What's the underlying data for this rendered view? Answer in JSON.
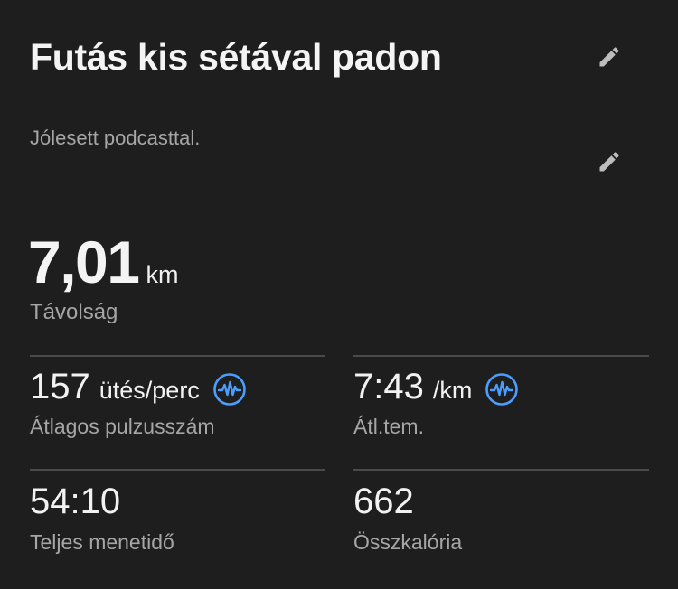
{
  "activity": {
    "title": "Futás kis sétával padon",
    "notes": "Jólesett podcasttal."
  },
  "distance": {
    "value": "7,01",
    "unit": "km",
    "label": "Távolság"
  },
  "stats": [
    {
      "value": "157",
      "unit": "ütés/perc",
      "label": "Átlagos pulzusszám",
      "icon": "heart-rate-chart-icon"
    },
    {
      "value": "7:43",
      "unit": "/km",
      "label": "Átl.tem.",
      "icon": "pace-chart-icon"
    },
    {
      "value": "54:10",
      "unit": "",
      "label": "Teljes menetidő"
    },
    {
      "value": "662",
      "unit": "",
      "label": "Összkalória"
    }
  ],
  "icons": {
    "edit": "pencil-icon"
  },
  "colors": {
    "background": "#1e1e1e",
    "accent": "#4a9eff",
    "secondary_text": "#a6a6a6",
    "divider": "#4a4a4a"
  }
}
